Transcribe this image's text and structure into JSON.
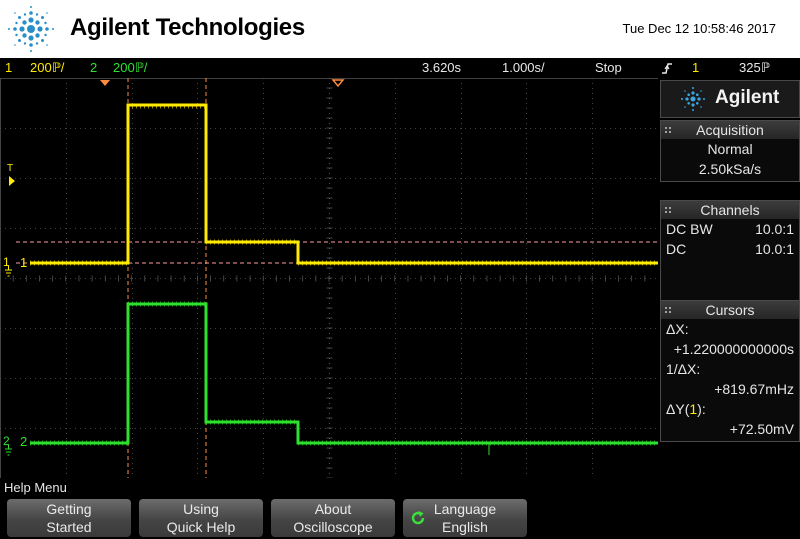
{
  "header": {
    "brand": "Agilent Technologies",
    "datetime": "Tue Dec 12 10:58:46 2017",
    "logo_icon": "agilent-spark-logo"
  },
  "status_bar": {
    "ch1_number": "1",
    "ch1_scale": "200ℙ/",
    "ch2_number": "2",
    "ch2_scale": "200ℙ/",
    "time_delay": "3.620s",
    "time_base": "1.000s/",
    "run_state": "Stop",
    "trigger_icon": "trigger-slope-icon",
    "trigger_source": "1",
    "trigger_level": "325ℙ"
  },
  "plot": {
    "ch1_marker": "1",
    "ch2_marker": "2",
    "trigger_marker": "T",
    "colors": {
      "ch1": "#ffea00",
      "ch2": "#2fe02f",
      "cursor": "#ff8c3a",
      "grid": "#555555"
    }
  },
  "side_panel": {
    "brand": "Agilent",
    "acquisition": {
      "title": "Acquisition",
      "mode": "Normal",
      "sample_rate": "2.50kSa/s"
    },
    "channels": {
      "title": "Channels",
      "rows": [
        {
          "coupling": "DC BW",
          "probe": "10.0:1"
        },
        {
          "coupling": "DC",
          "probe": "10.0:1"
        }
      ]
    },
    "cursors": {
      "title": "Cursors",
      "dx_label": "ΔX:",
      "dx_value": "+1.220000000000s",
      "inv_dx_label": "1/ΔX:",
      "inv_dx_value": "+819.67mHz",
      "dy_label_prefix": "ΔY(",
      "dy_channel": "1",
      "dy_label_suffix": "):",
      "dy_value": "+72.50mV"
    }
  },
  "help_menu": {
    "title": "Help Menu",
    "softkeys": [
      {
        "line1": "Getting",
        "line2": "Started"
      },
      {
        "line1": "Using",
        "line2": "Quick Help"
      },
      {
        "line1": "About",
        "line2": "Oscilloscope"
      },
      {
        "line1": "Language",
        "line2": "English",
        "icon": "cycle-arrow-icon"
      }
    ]
  }
}
